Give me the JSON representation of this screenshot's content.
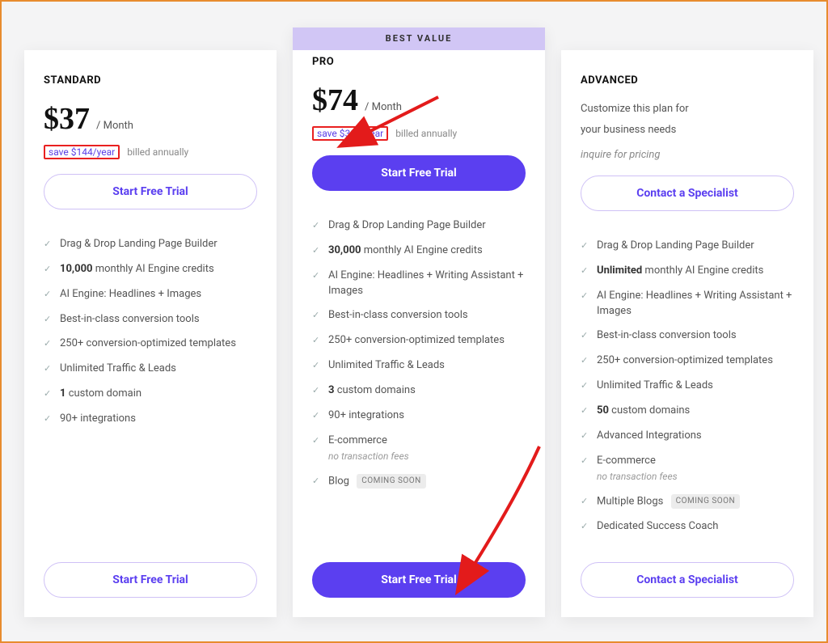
{
  "best_value_label": "BEST VALUE",
  "coming_soon_label": "COMING SOON",
  "standard": {
    "name": "STANDARD",
    "price": "$37",
    "period": "/ Month",
    "save": "save $144/year",
    "billing_note": "billed annually",
    "cta": "Start Free Trial",
    "features": {
      "f1": "Drag & Drop Landing Page Builder",
      "f2a": "10,000",
      "f2b": " monthly AI Engine credits",
      "f3": "AI Engine: Headlines + Images",
      "f4": "Best-in-class conversion tools",
      "f5": "250+ conversion-optimized templates",
      "f6": "Unlimited Traffic & Leads",
      "f7a": "1",
      "f7b": " custom domain",
      "f8": "90+ integrations"
    }
  },
  "pro": {
    "name": "PRO",
    "price": "$74",
    "period": "/ Month",
    "save": "save $300/year",
    "billing_note": "billed annually",
    "cta": "Start Free Trial",
    "features": {
      "f1": "Drag & Drop Landing Page Builder",
      "f2a": "30,000",
      "f2b": " monthly AI Engine credits",
      "f3": "AI Engine: Headlines + Writing Assistant + Images",
      "f4": "Best-in-class conversion tools",
      "f5": "250+ conversion-optimized templates",
      "f6": "Unlimited Traffic & Leads",
      "f7a": "3",
      "f7b": " custom domains",
      "f8": "90+ integrations",
      "f9": "E-commerce",
      "f9_note": "no transaction fees",
      "f10": "Blog"
    }
  },
  "advanced": {
    "name": "ADVANCED",
    "desc1": "Customize this plan for",
    "desc2": "your business needs",
    "inquire": "inquire for pricing",
    "cta": "Contact a Specialist",
    "features": {
      "f1": "Drag & Drop Landing Page Builder",
      "f2a": "Unlimited",
      "f2b": " monthly AI Engine credits",
      "f3": "AI Engine: Headlines + Writing Assistant + Images",
      "f4": "Best-in-class conversion tools",
      "f5": "250+ conversion-optimized templates",
      "f6": "Unlimited Traffic & Leads",
      "f7a": "50",
      "f7b": " custom domains",
      "f8": "Advanced Integrations",
      "f9": "E-commerce",
      "f9_note": "no transaction fees",
      "f10": "Multiple Blogs",
      "f11": "Dedicated Success Coach"
    }
  }
}
